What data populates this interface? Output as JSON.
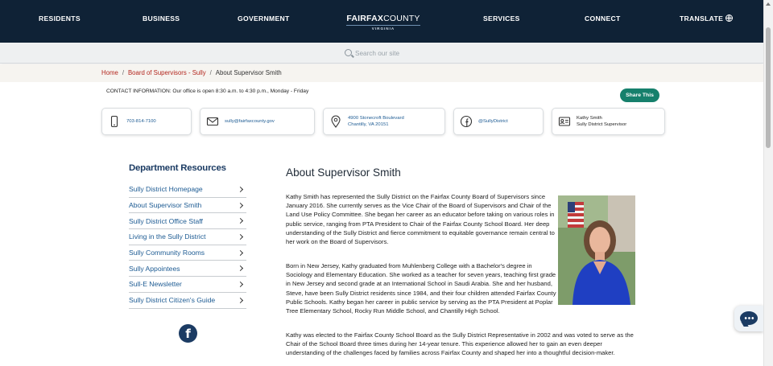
{
  "nav": {
    "residents": "RESIDENTS",
    "business": "BUSINESS",
    "government": "GOVERNMENT",
    "logo_bold": "FAIRFAX",
    "logo_regular": "COUNTY",
    "logo_sub": "VIRGINIA",
    "services": "SERVICES",
    "connect": "CONNECT",
    "translate": "TRANSLATE",
    "translate_icon": "globe-icon"
  },
  "search": {
    "placeholder": "Search our site",
    "icon": "search-icon"
  },
  "breadcrumb": {
    "home": "Home",
    "section": "Board of Supervisors - Sully",
    "current": "About Supervisor Smith",
    "separator": "/"
  },
  "contact": {
    "info": "CONTACT INFORMATION: Our office is open 8:30 a.m. to 4:30 p.m., Monday - Friday",
    "share_label": "Share This",
    "phone": "703-814-7100",
    "email": "sully@fairfaxcounty.gov",
    "address_line1": "4900 Stonecroft Boulevard",
    "address_line2": "Chantilly, VA 20151",
    "social": "@SullyDistrict",
    "person_name": "Kathy Smith",
    "person_title": "Sully District Supervisor"
  },
  "sidebar": {
    "title": "Department Resources",
    "items": [
      {
        "label": "Sully District Homepage"
      },
      {
        "label": "About Supervisor Smith"
      },
      {
        "label": "Sully District Office Staff"
      },
      {
        "label": "Living in the Sully District"
      },
      {
        "label": "Sully Community Rooms"
      },
      {
        "label": "Sully Appointees"
      },
      {
        "label": "Sull-E Newsletter"
      },
      {
        "label": "Sully District Citizen's Guide"
      }
    ],
    "facebook_glyph": "f"
  },
  "main": {
    "title": "About Supervisor Smith",
    "paragraphs": [
      "Kathy Smith has represented the Sully District on the Fairfax County Board of Supervisors since January 2016. She currently serves as the Vice Chair of the Board of Supervisors and Chair of the Land Use Policy Committee. She began her career as an educator before taking on various roles in public service, ranging from PTA President to Chair of the Fairfax County School Board. Her deep understanding of the Sully District and fierce commitment to equitable governance remain central to her work on the Board of Supervisors.",
      "Born in New Jersey, Kathy graduated from Muhlenberg College with a Bachelor's degree in Sociology and Elementary Education. She worked as a teacher for seven years, teaching first grade in New Jersey and second grade at an International School in Saudi Arabia. She and her husband, Steve, have been Sully District residents since 1984, and their four children attended Fairfax County Public Schools. Kathy began her career in public service by serving as the PTA President at Poplar Tree Elementary School, Rocky Run Middle School, and Chantilly High School.",
      "Kathy was elected to the Fairfax County School Board as the Sully District Representative in 2002 and was voted to serve as the Chair of the School Board three times during her 14-year tenure. This experience allowed her to gain an even deeper understanding of the challenges faced by families across Fairfax County and shaped her into a thoughtful decision-maker."
    ]
  },
  "colors": {
    "nav_bg": "#0f2236",
    "link_red": "#b3261e",
    "link_blue": "#1d5b93",
    "heading_navy": "#1b3b63",
    "share_green": "#16806c"
  }
}
